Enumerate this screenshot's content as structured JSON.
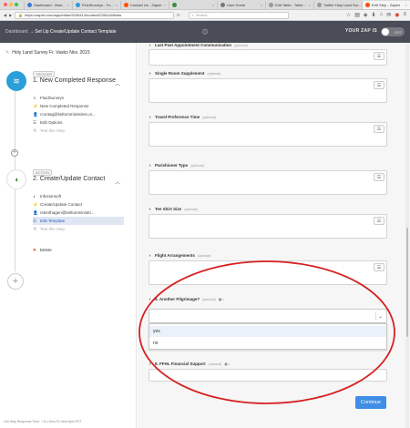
{
  "browser": {
    "tabs": [
      {
        "label": "Dashboard - Marl...",
        "color": "#3a7bd5",
        "active": false
      },
      {
        "label": "FluidSurveys - Fo...",
        "color": "#2e9bd6",
        "active": false
      },
      {
        "label": "Contact Us - Zapier",
        "color": "#ff4f00",
        "active": false
      },
      {
        "label": "",
        "color": "#3c8a3d",
        "active": false
      },
      {
        "label": "User Home",
        "color": "#777777",
        "active": false
      },
      {
        "label": "Edit Table - Table...",
        "color": "#999999",
        "active": false
      },
      {
        "label": "Twitter Holy Land Sur...",
        "color": "#999999",
        "active": false
      },
      {
        "label": "Edit Step - Zapier",
        "color": "#ff4f00",
        "active": true
      }
    ],
    "url": "https://zapier.com/app/editor/5235413/nodes/5235418/fields",
    "search_placeholder": "Search"
  },
  "appbar": {
    "breadcrumb_dashboard": "Dashboard",
    "breadcrumb_rest": "→ Set Up Create/Update Contact Template",
    "zap_status_label": "YOUR ZAP IS",
    "toggle_label": "OFF"
  },
  "sidebar": {
    "zap_title": "Holy Land Survey Fr. Vasko Nov. 2015",
    "steps": [
      {
        "badge": "TRIGGER",
        "name": "1. New Completed Response",
        "icon_color": "#2b9fd9",
        "items": [
          {
            "label": "FluidSurveys",
            "bullet": "≡",
            "state": "normal"
          },
          {
            "label": "New Completed Response",
            "bullet": "⚡",
            "state": "normal"
          },
          {
            "label": "rcontag@keltomministries.or...",
            "bullet": "👤",
            "state": "normal"
          },
          {
            "label": "Edit Options",
            "bullet": "☰",
            "state": "normal"
          },
          {
            "label": "Test this Step",
            "bullet": "⚗",
            "state": "muted"
          }
        ]
      },
      {
        "badge": "ACTION",
        "name": "2. Create/Update Contact",
        "icon_color": "#3c8a3d",
        "items": [
          {
            "label": "Infusionsoft",
            "bullet": "◐",
            "state": "normal"
          },
          {
            "label": "Create/Update Contact",
            "bullet": "⚡",
            "state": "normal"
          },
          {
            "label": "rstenthagen@keltomministri...",
            "bullet": "👤",
            "state": "normal"
          },
          {
            "label": "Edit Template",
            "bullet": "☰",
            "state": "selected"
          },
          {
            "label": "Test this Step",
            "bullet": "⚗",
            "state": "muted"
          }
        ]
      }
    ],
    "delete_label": "Delete",
    "footer": "Get Help  Response Time: ~1h | Mon-Fri 9am-5pm PST"
  },
  "form": {
    "fields": [
      {
        "label": "Last Past Appointment Communication",
        "optional": "(optional)"
      },
      {
        "label": "Single Room Supplement",
        "optional": "(optional)"
      },
      {
        "label": "Travel Preference Time",
        "optional": "(optional)"
      },
      {
        "label": "Parishioner Type",
        "optional": "(optional)"
      },
      {
        "label": "Tee Shirt Size",
        "optional": "(optional)"
      },
      {
        "label": "Flight Arrangements",
        "optional": "(optional)"
      },
      {
        "label": "4. Another Pilgrimage?",
        "optional": "(optional)"
      },
      {
        "label": "8. FFHL Financial Support",
        "optional": "(optional)"
      }
    ],
    "dropdown_options": [
      "yes",
      "no"
    ],
    "continue_label": "Continue"
  },
  "annotation": {
    "ellipse_color": "#d62020"
  }
}
